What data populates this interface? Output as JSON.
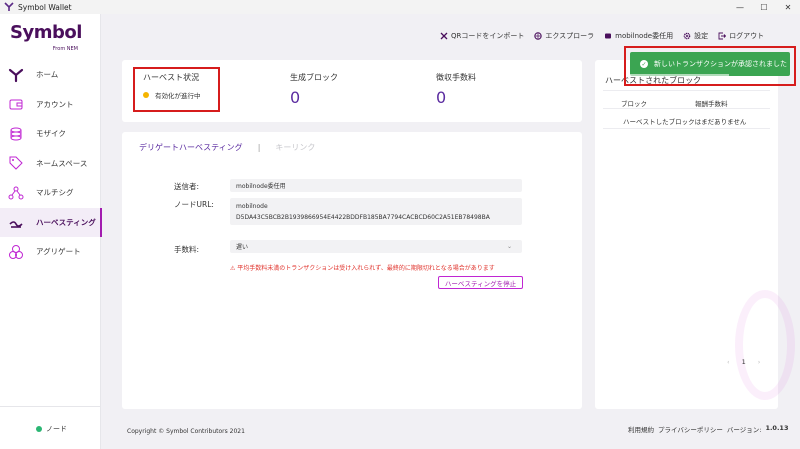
{
  "window": {
    "title": "Symbol Wallet",
    "app_icon": "symbol-logo-icon"
  },
  "logo": {
    "word": "Symbol",
    "sub": "From NEM"
  },
  "sidebar": {
    "items": [
      {
        "label": "ホーム",
        "icon": "home-icon"
      },
      {
        "label": "アカウント",
        "icon": "wallet-icon"
      },
      {
        "label": "モザイク",
        "icon": "mosaic-icon"
      },
      {
        "label": "ネームスペース",
        "icon": "tag-icon"
      },
      {
        "label": "マルチシグ",
        "icon": "multisig-icon"
      },
      {
        "label": "ハーベスティング",
        "icon": "harvesting-icon"
      },
      {
        "label": "アグリゲート",
        "icon": "aggregate-icon"
      }
    ],
    "active_index": 5,
    "node_label": "ノード",
    "node_status_color": "#2bb673"
  },
  "toolbar": {
    "import_qr": "QRコードをインポート",
    "explorer": "エクスプローラ",
    "node": "mobilnode委任用",
    "settings": "設定",
    "logout": "ログアウト"
  },
  "toast": {
    "message": "新しいトランザクションが承認されました",
    "color": "#3ba552"
  },
  "stats": {
    "harvest_status_title": "ハーベスト状況",
    "harvest_status_value": "有効化が進行中",
    "blocks_title": "生成ブロック",
    "blocks_value": "0",
    "fees_title": "徴収手数料",
    "fees_value": "0"
  },
  "form": {
    "tab_delegated": "デリゲートハーベスティング",
    "tab_keylink": "キーリンク",
    "sender_label": "送信者:",
    "sender_value": "mobilnode委任用",
    "node_url_label": "ノードURL:",
    "node_url_name": "mobilnode",
    "node_url_key": "D5DA43C5BCB2B1939866954E4422BDDFB185BA7794CACBCD60C2A51EB78498BA",
    "fee_label": "手数料:",
    "fee_value": "遅い",
    "warning": "⚠ 平均手数料未満のトランザクションは受け入れられず、最終的に期限切れとなる場合があります",
    "stop_button": "ハーベスティングを停止"
  },
  "right_panel": {
    "title": "ハーベストされたブロック",
    "col_block": "ブロック",
    "col_fee": "報酬手数料",
    "empty": "ハーベストしたブロックはまだありません",
    "page": "1"
  },
  "footer": {
    "copyright": "Copyright © Symbol Contributors 2021",
    "terms": "利用規約",
    "privacy": "プライバシーポリシー",
    "version_label": "バージョン:",
    "version": "1.0.13"
  },
  "colors": {
    "brand": "#4a0f5c",
    "accent": "#a21caf",
    "highlight": "#d61c1c",
    "value": "#5b2ca0"
  }
}
